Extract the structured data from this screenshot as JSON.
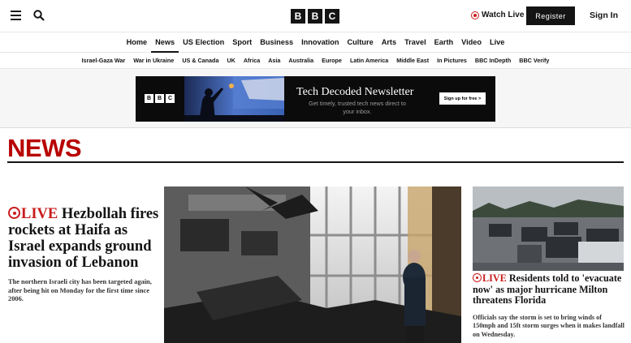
{
  "header": {
    "menu_icon": "hamburger-menu-icon",
    "search_icon": "magnifier-search-icon",
    "logo_letters": [
      "B",
      "B",
      "C"
    ],
    "watch_live": "Watch Live",
    "register": "Register",
    "sign_in": "Sign In"
  },
  "main_nav": [
    "Home",
    "News",
    "US Election",
    "Sport",
    "Business",
    "Innovation",
    "Culture",
    "Arts",
    "Travel",
    "Earth",
    "Video",
    "Live"
  ],
  "main_nav_active": "News",
  "sub_nav": [
    "Israel-Gaza War",
    "War in Ukraine",
    "US & Canada",
    "UK",
    "Africa",
    "Asia",
    "Australia",
    "Europe",
    "Latin America",
    "Middle East",
    "In Pictures",
    "BBC InDepth",
    "BBC Verify"
  ],
  "ad": {
    "logo_letters": [
      "B",
      "B",
      "C"
    ],
    "title": "Tech Decoded Newsletter",
    "subtitle": "Get timely, trusted tech news direct to your inbox.",
    "cta": "Sign up for free >"
  },
  "section_title": "NEWS",
  "lead_story": {
    "live_label": "LIVE",
    "headline": "Hezbollah fires rockets at Haifa as Israel expands ground invasion of Lebanon",
    "summary": "The northern Israeli city has been targeted again, after being hit on Monday for the first time since 2006."
  },
  "side_story": {
    "live_label": "LIVE",
    "headline": "Residents told to 'evacuate now' as major hurricane Milton threatens Florida",
    "summary": "Officials say the storm is set to bring winds of 150mph and 15ft storm surges when it makes landfall on Wednesday."
  },
  "colors": {
    "brand_red": "#b80000",
    "live_red": "#c91c1c",
    "text": "#141414"
  }
}
